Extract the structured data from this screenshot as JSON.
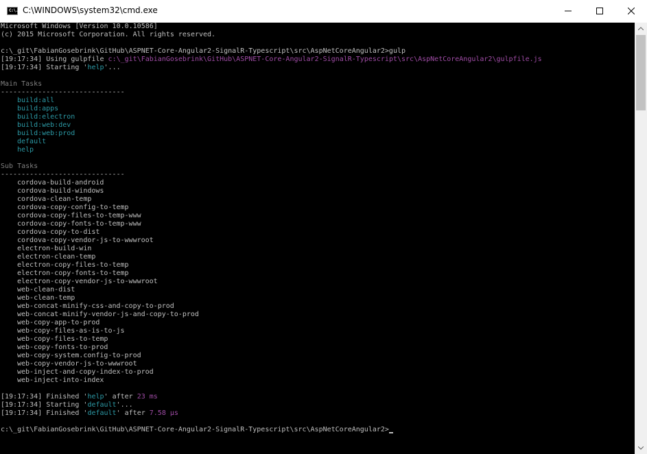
{
  "window": {
    "title": "C:\\WINDOWS\\system32\\cmd.exe",
    "icon": "cmd-icon",
    "icon_text": "C:\\.",
    "controls": [
      "minimize-icon",
      "maximize-icon",
      "close-icon"
    ]
  },
  "colors": {
    "background": "#000000",
    "text": "#c0c0c0",
    "cyan": "#2c9aa6",
    "magenta": "#a04ca6",
    "gray": "#808080",
    "titlebar": "#ffffff",
    "scrollbar": "#f0f0f0"
  },
  "console": {
    "line1": "Microsoft Windows [Version 10.0.10586]",
    "line2": "(c) 2015 Microsoft Corporation. All rights reserved.",
    "prompt1": "c:\\_git\\FabianGosebrink\\GitHub\\ASPNET-Core-Angular2-SignalR-Typescript\\src\\AspNetCoreAngular2>gulp",
    "using_prefix": "[19:17:34] Using gulpfile ",
    "gulpfile_path": "c:\\_git\\FabianGosebrink\\GitHub\\ASPNET-Core-Angular2-SignalR-Typescript\\src\\AspNetCoreAngular2\\gulpfile.js",
    "starting_help_prefix": "[19:17:34] Starting '",
    "help_task": "help",
    "starting_help_suffix": "'...",
    "main_tasks_heading": "Main Tasks",
    "separator": "------------------------------",
    "main_tasks": [
      "build:all",
      "build:apps",
      "build:electron",
      "build:web:dev",
      "build:web:prod",
      "default",
      "help"
    ],
    "sub_tasks_heading": "Sub Tasks",
    "sub_tasks": [
      "cordova-build-android",
      "cordova-build-windows",
      "cordova-clean-temp",
      "cordova-copy-config-to-temp",
      "cordova-copy-files-to-temp-www",
      "cordova-copy-fonts-to-temp-www",
      "cordova-copy-to-dist",
      "cordova-copy-vendor-js-to-wwwroot",
      "electron-build-win",
      "electron-clean-temp",
      "electron-copy-files-to-temp",
      "electron-copy-fonts-to-temp",
      "electron-copy-vendor-js-to-wwwroot",
      "web-clean-dist",
      "web-clean-temp",
      "web-concat-minify-css-and-copy-to-prod",
      "web-concat-minify-vendor-js-and-copy-to-prod",
      "web-copy-app-to-prod",
      "web-copy-files-as-is-to-js",
      "web-copy-files-to-temp",
      "web-copy-fonts-to-prod",
      "web-copy-system.config-to-prod",
      "web-copy-vendor-js-to-wwwroot",
      "web-inject-and-copy-index-to-prod",
      "web-inject-into-index"
    ],
    "finished_help_prefix": "[19:17:34] Finished '",
    "finished_help_mid": "' after ",
    "finished_help_time": "23 ms",
    "starting_default_prefix": "[19:17:34] Starting '",
    "default_task": "default",
    "starting_default_suffix": "'...",
    "finished_default_prefix": "[19:17:34] Finished '",
    "finished_default_mid": "' after ",
    "finished_default_time": "7.58 μs",
    "prompt2": "c:\\_git\\FabianGosebrink\\GitHub\\ASPNET-Core-Angular2-SignalR-Typescript\\src\\AspNetCoreAngular2>"
  }
}
